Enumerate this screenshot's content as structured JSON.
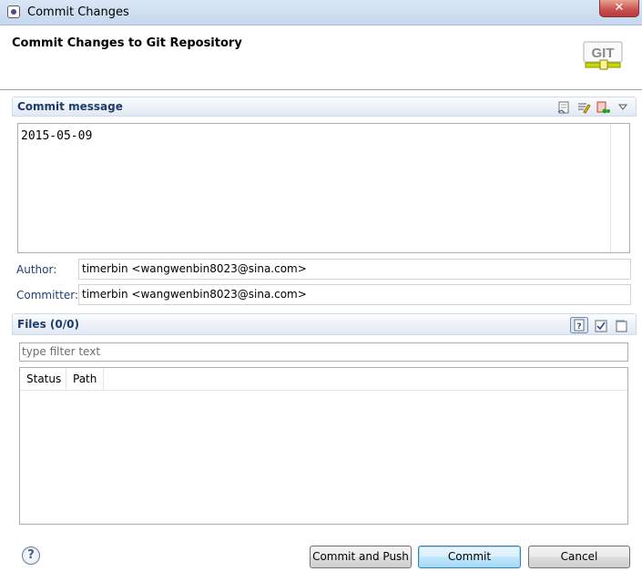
{
  "window": {
    "title": "Commit Changes",
    "close_glyph": "✕"
  },
  "banner": {
    "title": "Commit Changes to Git Repository",
    "logo_text": "GIT"
  },
  "commit_message": {
    "section_title": "Commit message",
    "value": "2015-05-09",
    "toolbar_icons": [
      "sign-off-icon",
      "amend-icon",
      "add-change-id-icon",
      "view-menu-icon"
    ]
  },
  "author": {
    "label": "Author:",
    "value": "timerbin <wangwenbin8023@sina.com>"
  },
  "committer": {
    "label": "Committer:",
    "value": "timerbin <wangwenbin8023@sina.com>"
  },
  "files": {
    "section_title": "Files (0/0)",
    "filter_placeholder": "type filter text",
    "columns": [
      "Status",
      "Path"
    ],
    "rows": [],
    "toolbar_icons": [
      "show-untracked-icon",
      "select-all-icon",
      "deselect-all-icon"
    ]
  },
  "buttons": {
    "help": "?",
    "commit_and_push": "Commit and Push",
    "commit": "Commit",
    "cancel": "Cancel"
  }
}
